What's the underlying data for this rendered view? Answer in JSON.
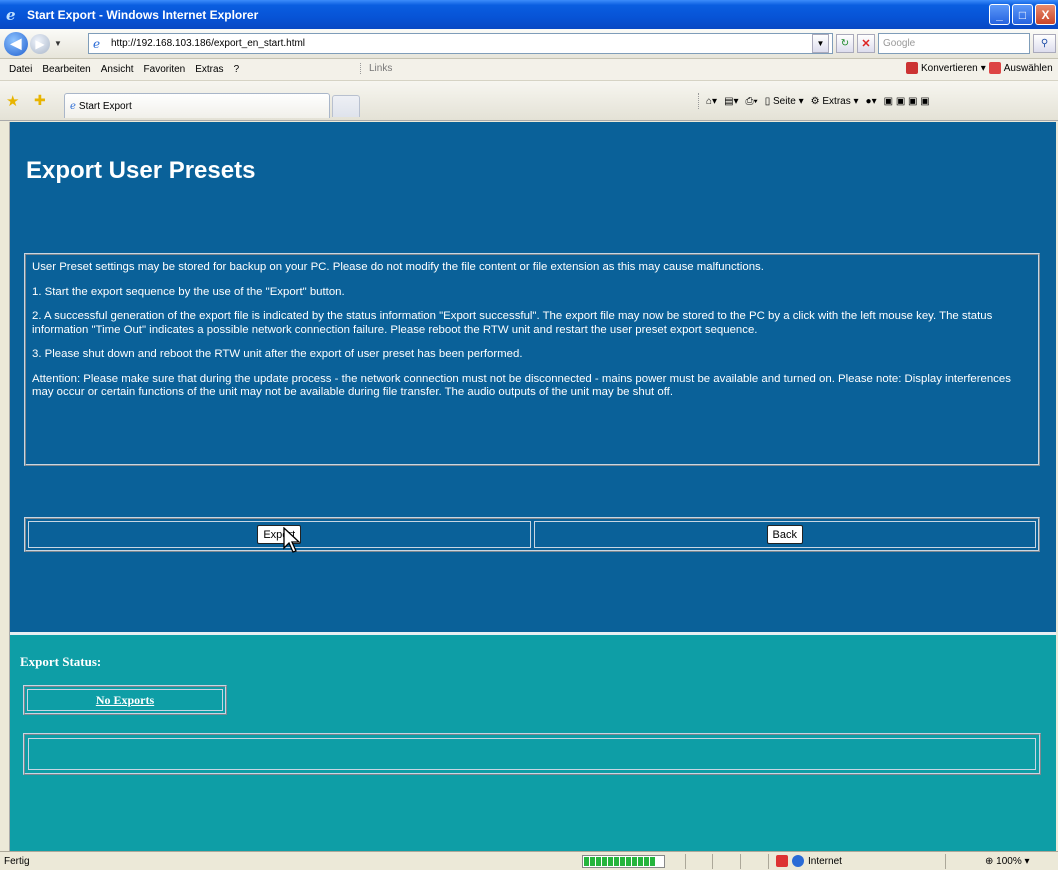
{
  "window": {
    "title": "Start Export - Windows Internet Explorer",
    "minimize": "_",
    "maximize": "□",
    "close": "X"
  },
  "address_bar": {
    "url": "http://192.168.103.186/export_en_start.html",
    "search_placeholder": "Google"
  },
  "menu": {
    "items": [
      "Datei",
      "Bearbeiten",
      "Ansicht",
      "Favoriten",
      "Extras",
      "?"
    ],
    "links_label": "Links",
    "konvertieren": "Konvertieren",
    "auswaehlen": "Auswählen"
  },
  "tabs": {
    "active_tab": "Start Export"
  },
  "command_bar": {
    "seite": "Seite",
    "extras": "Extras"
  },
  "page": {
    "title": "Export User Presets",
    "info_paragraphs": [
      "User Preset settings may be stored for backup on your PC. Please do not modify the file content or file extension as this may cause malfunctions.",
      "1. Start the export sequence by the use of the \"Export\" button.",
      "2. A successful generation of the export file is indicated by the status information \"Export successful\". The export file may now be stored to the PC by a click with the left mouse key. The status information \"Time Out\" indicates a possible network connection failure. Please reboot the RTW unit and restart the user preset export sequence.",
      "3. Please shut down and reboot the RTW unit after the export of user preset has been performed.",
      "Attention: Please make sure that during the update process - the network connection must not be disconnected - mains power must be available and turned on. Please note: Display interferences may occur or certain functions of the unit may not be available during file transfer. The audio outputs of the unit may be shut off."
    ],
    "export_button": "Export",
    "back_button": "Back",
    "status_label": "Export Status:",
    "status_value": "No Exports"
  },
  "statusbar": {
    "text": "Fertig",
    "zone": "Internet",
    "zoom": "100%"
  }
}
